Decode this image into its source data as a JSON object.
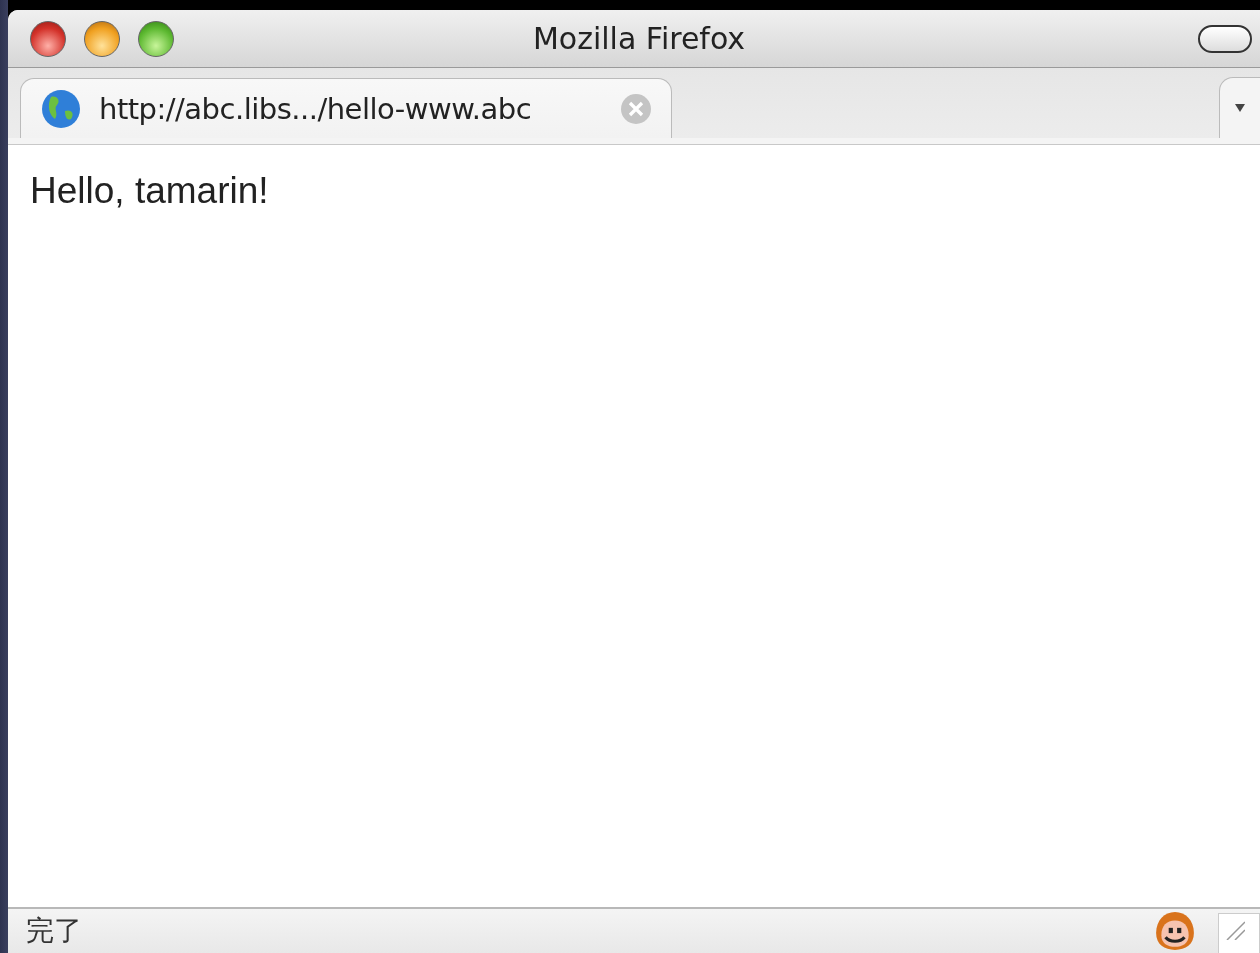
{
  "window": {
    "title": "Mozilla Firefox"
  },
  "tabs": [
    {
      "label": "http://abc.libs.../hello-www.abc",
      "selected": true
    }
  ],
  "content": {
    "text": "Hello, tamarin!"
  },
  "status_bar": {
    "text": "完了"
  }
}
